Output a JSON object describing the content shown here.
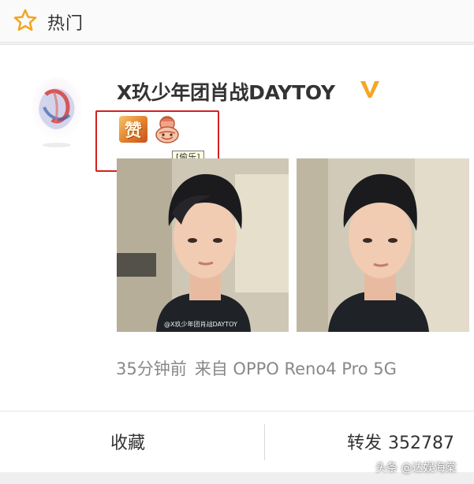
{
  "header": {
    "title": "热门",
    "icon": "star-icon",
    "icon_color": "#f5a623"
  },
  "post": {
    "username": "X玖少年团肖战DAYTOY",
    "verified_icon": "verified-v-icon",
    "verified_color": "#f5a623",
    "emoji_zan_text": "赞",
    "emoji_tooltip": "[偷乐]",
    "highlight_color": "#d62020",
    "photo_watermark": "@X玖少年团肖战DAYTOY",
    "time": "35分钟前",
    "source": "来自 OPPO Reno4 Pro 5G"
  },
  "actions": {
    "favorite_label": "收藏",
    "forward_label": "转发",
    "forward_count": "352787"
  },
  "source_tag": "头条 @达娱海棠"
}
